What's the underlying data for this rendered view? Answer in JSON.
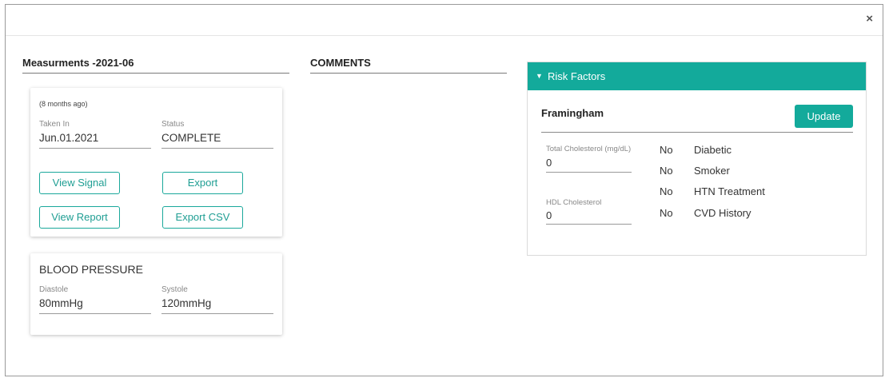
{
  "close_icon": "×",
  "columns": {
    "measurements_title": "Measurments -2021-06",
    "comments_title": "COMMENTS"
  },
  "measurement_card": {
    "ago": "(8 months ago)",
    "taken_in_label": "Taken In",
    "taken_in_value": "Jun.01.2021",
    "status_label": "Status",
    "status_value": "COMPLETE",
    "buttons": {
      "view_signal": "View Signal",
      "export": "Export",
      "view_report": "View Report",
      "export_csv": "Export CSV"
    }
  },
  "blood_pressure": {
    "title": "BLOOD PRESSURE",
    "diastole_label": "Diastole",
    "diastole_value": "80mmHg",
    "systole_label": "Systole",
    "systole_value": "120mmHg"
  },
  "risk_factors": {
    "header": "Risk Factors",
    "toggle_icon": "▼",
    "section_title": "Framingham",
    "update_label": "Update",
    "total_chol_label": "Total Cholesterol (mg/dL)",
    "total_chol_value": "0",
    "hdl_label": "HDL Cholesterol",
    "hdl_value": "0",
    "factors": [
      {
        "value": "No",
        "label": "Diabetic"
      },
      {
        "value": "No",
        "label": "Smoker"
      },
      {
        "value": "No",
        "label": "HTN Treatment"
      },
      {
        "value": "No",
        "label": "CVD History"
      }
    ]
  },
  "colors": {
    "accent": "#13aa9b",
    "border": "#9a9a9a"
  }
}
